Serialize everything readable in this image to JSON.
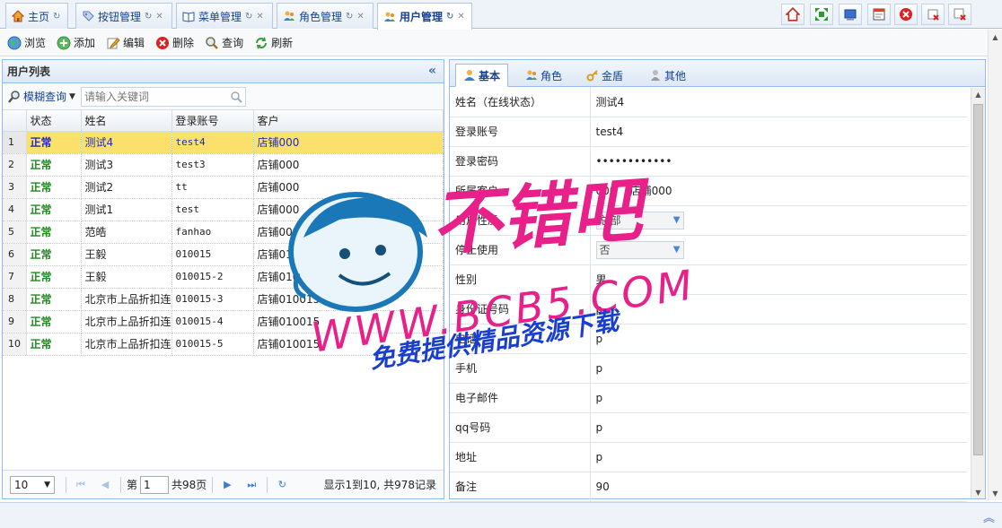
{
  "tabs": [
    {
      "label": "主页",
      "icon": "home-icon",
      "closable": false
    },
    {
      "label": "按钮管理",
      "icon": "tag-icon",
      "closable": true
    },
    {
      "label": "菜单管理",
      "icon": "book-icon",
      "closable": true
    },
    {
      "label": "角色管理",
      "icon": "users-icon",
      "closable": true
    },
    {
      "label": "用户管理",
      "icon": "users-icon",
      "closable": true,
      "active": true
    }
  ],
  "window_buttons": [
    "home-icon",
    "fullscreen-icon",
    "window-icon",
    "calendar-icon",
    "close-red-icon",
    "close-others-icon",
    "close-all-icon"
  ],
  "toolbar": {
    "browse": "浏览",
    "add": "添加",
    "edit": "编辑",
    "delete": "删除",
    "query": "查询",
    "refresh": "刷新"
  },
  "user_list": {
    "title": "用户列表",
    "fuzzy_label": "模糊查询",
    "search_placeholder": "请输入关键词",
    "columns": [
      "状态",
      "姓名",
      "登录账号",
      "客户"
    ],
    "rows": [
      {
        "n": "1",
        "status": "正常",
        "name": "测试4",
        "account": "test4",
        "customer": "店铺000"
      },
      {
        "n": "2",
        "status": "正常",
        "name": "测试3",
        "account": "test3",
        "customer": "店铺000"
      },
      {
        "n": "3",
        "status": "正常",
        "name": "测试2",
        "account": "tt",
        "customer": "店铺000"
      },
      {
        "n": "4",
        "status": "正常",
        "name": "测试1",
        "account": "test",
        "customer": "店铺000"
      },
      {
        "n": "5",
        "status": "正常",
        "name": "范皓",
        "account": "fanhao",
        "customer": "店铺000"
      },
      {
        "n": "6",
        "status": "正常",
        "name": "王毅",
        "account": "010015",
        "customer": "店铺010015"
      },
      {
        "n": "7",
        "status": "正常",
        "name": "王毅",
        "account": "010015-2",
        "customer": "店铺010015"
      },
      {
        "n": "8",
        "status": "正常",
        "name": "北京市上品折扣连",
        "account": "010015-3",
        "customer": "店铺010015"
      },
      {
        "n": "9",
        "status": "正常",
        "name": "北京市上品折扣连",
        "account": "010015-4",
        "customer": "店铺010015"
      },
      {
        "n": "10",
        "status": "正常",
        "name": "北京市上品折扣连",
        "account": "010015-5",
        "customer": "店铺010015"
      }
    ]
  },
  "pager": {
    "page_size": "10",
    "page_prefix": "第",
    "page": "1",
    "page_suffix": "共98页",
    "info": "显示1到10, 共978记录"
  },
  "detail_tabs": [
    {
      "label": "基本",
      "icon": "user-icon",
      "active": true
    },
    {
      "label": "角色",
      "icon": "users-icon"
    },
    {
      "label": "金盾",
      "icon": "key-icon"
    },
    {
      "label": "其他",
      "icon": "person-gray-icon"
    }
  ],
  "detail": {
    "name_label": "姓名（在线状态）",
    "name_value": "测试4",
    "account_label": "登录账号",
    "account_value": "test4",
    "password_label": "登录密码",
    "password_value": "••••••••••••",
    "customer_label": "所属客户",
    "customer_value": "000    店铺000",
    "nature_label": "用户性质",
    "nature_value": "总部",
    "stop_label": "停止使用",
    "stop_value": "否",
    "gender_label": "性别",
    "gender_value": "男",
    "idcard_label": "身份证号码",
    "idcard_value": "p",
    "phone_label": "电话",
    "phone_value": "p",
    "mobile_label": "手机",
    "mobile_value": "p",
    "email_label": "电子邮件",
    "email_value": "p",
    "qq_label": "qq号码",
    "qq_value": "p",
    "address_label": "地址",
    "address_value": "p",
    "remark_label": "备注",
    "remark_value": "90"
  },
  "watermark": {
    "brand": "不错吧",
    "url": "WWW.BCB5.COM",
    "slogan": "免费提供精品资源下载"
  },
  "colors": {
    "accent": "#15428b",
    "selected_row": "#fbe16b",
    "status_ok": "#1e8a1e",
    "panel_border": "#99bbe8",
    "watermark_pink": "#e8208a",
    "watermark_blue": "#1a3fcf"
  }
}
